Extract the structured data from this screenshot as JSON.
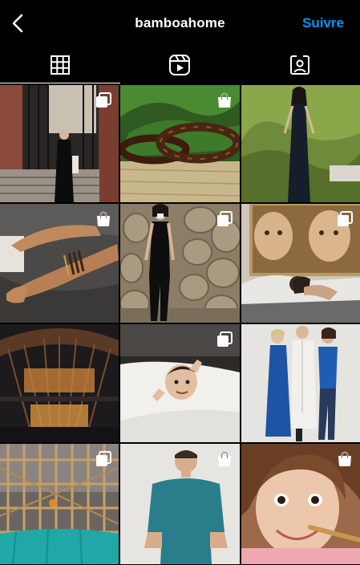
{
  "header": {
    "back_icon": "chevron-left-icon",
    "title": "bamboahome",
    "follow_label": "Suivre"
  },
  "tabs": [
    {
      "name": "grid",
      "icon": "grid-icon",
      "active": true
    },
    {
      "name": "reels",
      "icon": "reels-icon",
      "active": false
    },
    {
      "name": "tagged",
      "icon": "tagged-person-icon",
      "active": false
    }
  ],
  "colors": {
    "accent": "#0095f6",
    "background": "#000000",
    "text": "#ffffff"
  },
  "posts": [
    {
      "subject": "woman in black dress by brick gate",
      "badge": "multi-photo-icon"
    },
    {
      "subject": "tortoise bangles on bamboo",
      "badge": "shopping-bag-icon"
    },
    {
      "subject": "woman in navy maxi dress in garden",
      "badge": ""
    },
    {
      "subject": "hands with bracelets on grey sheets",
      "badge": "shopping-bag-icon"
    },
    {
      "subject": "woman in black jumpsuit by stone wall",
      "badge": "multi-photo-icon"
    },
    {
      "subject": "person resting under child portrait",
      "badge": "multi-photo-icon"
    },
    {
      "subject": "bamboo pavilion structure",
      "badge": ""
    },
    {
      "subject": "child waving in white bedding",
      "badge": "multi-photo-icon"
    },
    {
      "subject": "three people in blue and white robes",
      "badge": ""
    },
    {
      "subject": "bamboo scaffolding on building",
      "badge": "multi-photo-icon"
    },
    {
      "subject": "man in teal t-shirt",
      "badge": "shopping-bag-icon"
    },
    {
      "subject": "smiling toddler with toothbrush",
      "badge": "shopping-bag-icon"
    }
  ]
}
